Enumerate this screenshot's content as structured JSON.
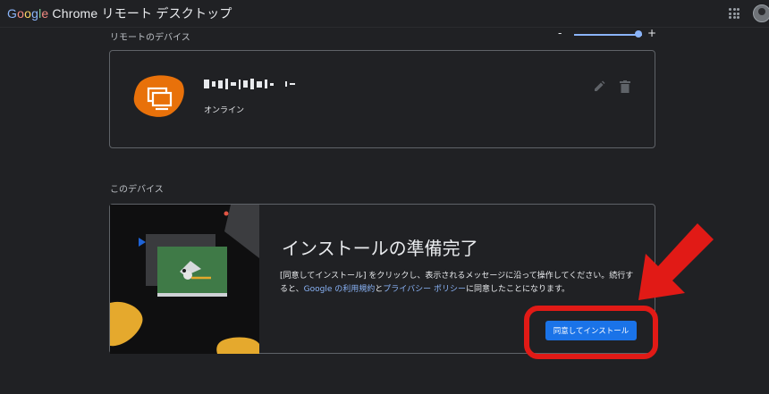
{
  "header": {
    "logo_google": "Google",
    "app_title": "Chrome リモート デスクトップ"
  },
  "remote_section": {
    "title": "リモートのデバイス",
    "zoom": {
      "minus": "-",
      "plus": "+",
      "level": 0.95
    },
    "device": {
      "status": "オンライン"
    }
  },
  "this_device_section": {
    "title": "このデバイス",
    "install": {
      "title": "インストールの準備完了",
      "desc_part1": "[同意してインストール] をクリックし、表示されるメッセージに沿って操作してください。続行すると、",
      "terms_link": "Google の利用規約",
      "desc_and": "と",
      "privacy_link": "プライバシー ポリシー",
      "desc_part2": "に同意したことになります。",
      "button_label": "同意してインストール"
    }
  },
  "colors": {
    "background": "#202124",
    "accent_blue": "#1a73e8",
    "device_orange": "#e8710a",
    "highlight_red": "#e11a16"
  }
}
